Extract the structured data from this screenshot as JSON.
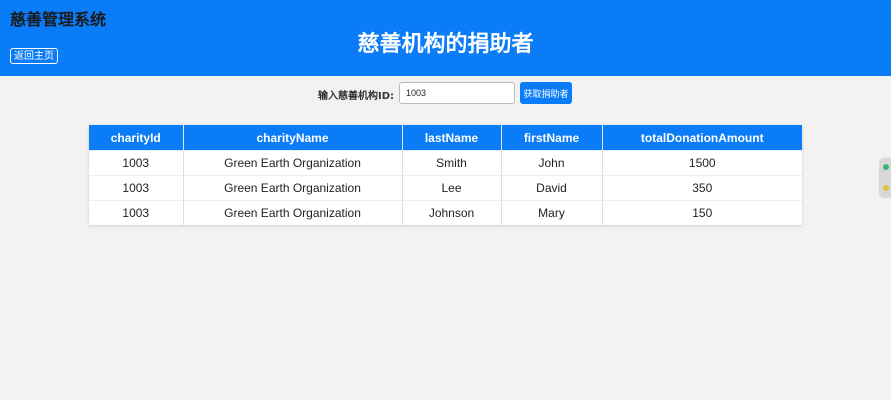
{
  "header": {
    "system_name": "慈善管理系统",
    "title": "慈善机构的捐助者",
    "back_button": "返回主页"
  },
  "search": {
    "label": "输入慈善机构ID:",
    "value": "1003",
    "button": "获取捐助者"
  },
  "table": {
    "columns": [
      "charityId",
      "charityName",
      "lastName",
      "firstName",
      "totalDonationAmount"
    ],
    "rows": [
      [
        "1003",
        "Green Earth Organization",
        "Smith",
        "John",
        "1500"
      ],
      [
        "1003",
        "Green Earth Organization",
        "Lee",
        "David",
        "350"
      ],
      [
        "1003",
        "Green Earth Organization",
        "Johnson",
        "Mary",
        "150"
      ]
    ]
  },
  "colors": {
    "accent": "#0a7cf8",
    "background": "#f2f2f2",
    "widget_dot_top": "#3cb371",
    "widget_dot_bottom": "#e0c040"
  }
}
